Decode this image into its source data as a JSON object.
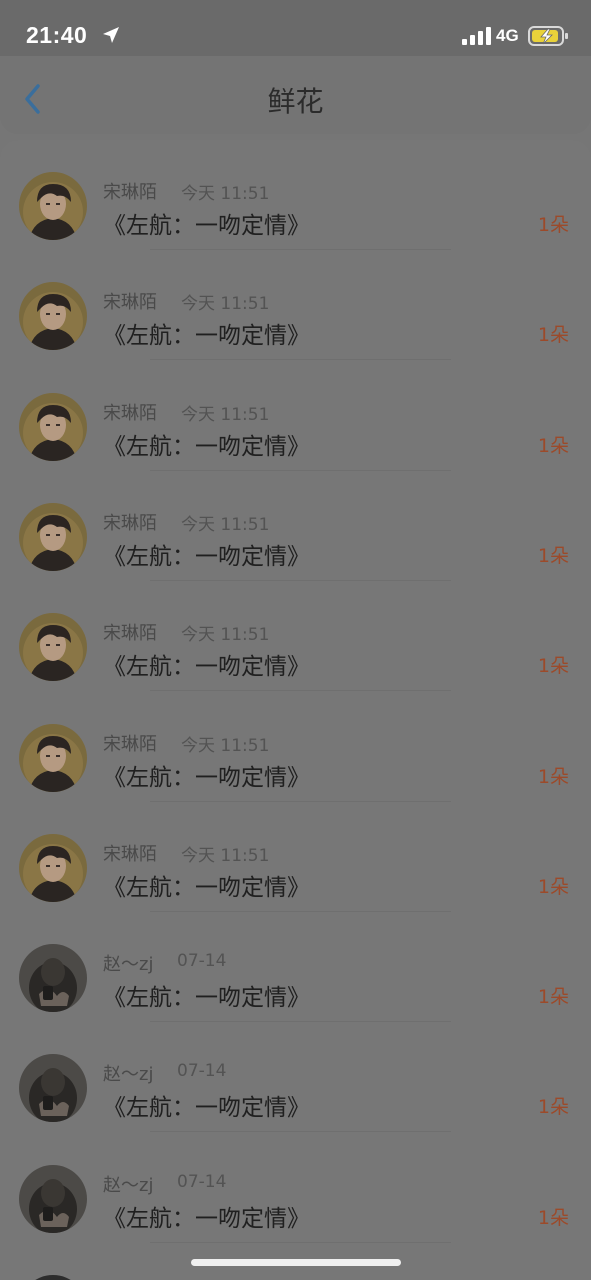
{
  "status_bar": {
    "time": "21:40",
    "network": "4G"
  },
  "header": {
    "title": "鲜花"
  },
  "items": [
    {
      "user": "宋琳陌",
      "time": "今天 11:51",
      "title": "《左航：一吻定情》",
      "count": "1朵",
      "avatar": "boy-portrait"
    },
    {
      "user": "宋琳陌",
      "time": "今天 11:51",
      "title": "《左航：一吻定情》",
      "count": "1朵",
      "avatar": "boy-portrait"
    },
    {
      "user": "宋琳陌",
      "time": "今天 11:51",
      "title": "《左航：一吻定情》",
      "count": "1朵",
      "avatar": "boy-portrait"
    },
    {
      "user": "宋琳陌",
      "time": "今天 11:51",
      "title": "《左航：一吻定情》",
      "count": "1朵",
      "avatar": "boy-portrait"
    },
    {
      "user": "宋琳陌",
      "time": "今天 11:51",
      "title": "《左航：一吻定情》",
      "count": "1朵",
      "avatar": "boy-portrait"
    },
    {
      "user": "宋琳陌",
      "time": "今天 11:51",
      "title": "《左航：一吻定情》",
      "count": "1朵",
      "avatar": "boy-portrait"
    },
    {
      "user": "宋琳陌",
      "time": "今天 11:51",
      "title": "《左航：一吻定情》",
      "count": "1朵",
      "avatar": "boy-portrait"
    },
    {
      "user": "赵～zj",
      "time": "07-14",
      "title": "《左航：一吻定情》",
      "count": "1朵",
      "avatar": "dark-portrait"
    },
    {
      "user": "赵～zj",
      "time": "07-14",
      "title": "《左航：一吻定情》",
      "count": "1朵",
      "avatar": "dark-portrait"
    },
    {
      "user": "赵～zj",
      "time": "07-14",
      "title": "《左航：一吻定情》",
      "count": "1朵",
      "avatar": "dark-portrait"
    }
  ],
  "colors": {
    "overlay": "#767676",
    "count_accent": "#9c4a2a",
    "back_icon": "#3a6e9c"
  }
}
